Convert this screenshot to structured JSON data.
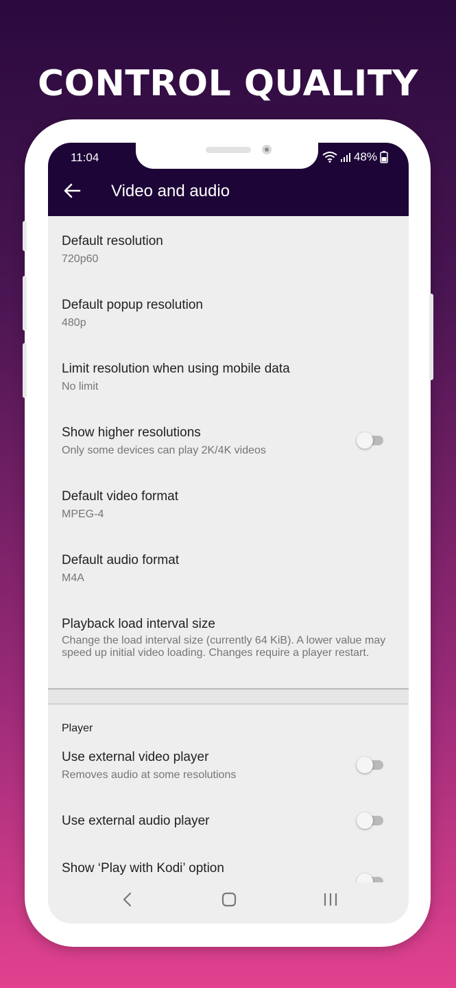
{
  "headline": "CONTROL QUALITY",
  "status_bar": {
    "time": "11:04",
    "battery": "48%"
  },
  "app_bar": {
    "title": "Video and audio"
  },
  "settings": [
    {
      "title": "Default resolution",
      "summary": "720p60"
    },
    {
      "title": "Default popup resolution",
      "summary": "480p"
    },
    {
      "title": "Limit resolution when using mobile data",
      "summary": "No limit"
    },
    {
      "title": "Show higher resolutions",
      "summary": "Only some devices can play 2K/4K videos",
      "toggle": false
    },
    {
      "title": "Default video format",
      "summary": "MPEG-4"
    },
    {
      "title": "Default audio format",
      "summary": "M4A"
    },
    {
      "title": "Playback load interval size",
      "summary": "Change the load interval size (currently 64 KiB). A lower value may speed up initial video loading. Changes require a player restart."
    }
  ],
  "player_section": {
    "header": "Player",
    "items": [
      {
        "title": "Use external video player",
        "summary": "Removes audio at some resolutions",
        "toggle": false
      },
      {
        "title": "Use external audio player",
        "toggle": false
      },
      {
        "title": "Show ‘Play with Kodi’ option",
        "toggle": false
      }
    ]
  },
  "colors": {
    "app_bar": "#1d0537",
    "screen_bg": "#eeeeee",
    "toggle_track": "#b9b9b9"
  },
  "icons": {
    "back": "arrow-left-icon",
    "wifi": "wifi-icon",
    "signal": "signal-icon",
    "battery": "battery-icon",
    "nav_back": "chevron-left-icon",
    "nav_home": "home-square-icon",
    "nav_recents": "recents-lines-icon"
  }
}
